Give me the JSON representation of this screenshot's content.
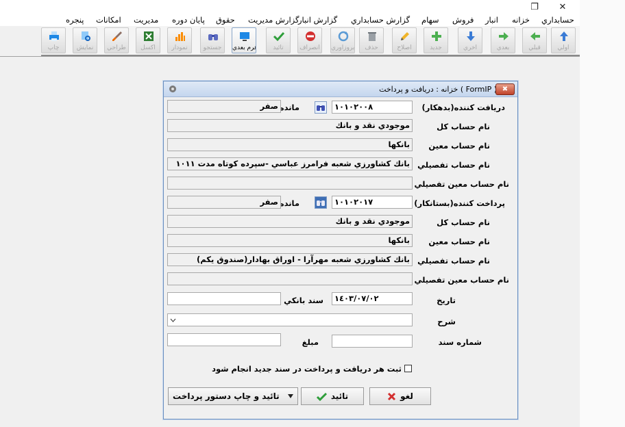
{
  "window": {
    "close_glyph": "✕",
    "restore_glyph": "❐"
  },
  "menu": [
    "حسابداري",
    "خزانه",
    "انبار",
    "فروش",
    "سهام",
    "گزارش حسابداري",
    "گزارش انبار",
    "گزارش مديريت",
    "حقوق",
    "پايان دوره",
    "مديريت",
    "امكانات",
    "پنجره"
  ],
  "toolbar": [
    {
      "label": "اولي",
      "icon": "up-arrow-icon"
    },
    {
      "label": "قبلي",
      "icon": "left-arrow-icon"
    },
    {
      "label": "بعدي",
      "icon": "right-arrow-icon"
    },
    {
      "label": "آخري",
      "icon": "down-arrow-icon"
    },
    {
      "label": "جديد",
      "icon": "plus-icon"
    },
    {
      "label": "اصلاح",
      "icon": "pencil-icon"
    },
    {
      "label": "حذف",
      "icon": "trash-icon"
    },
    {
      "label": "بروزآوري",
      "icon": "refresh-icon"
    },
    {
      "label": "انصراف",
      "icon": "cancel-icon"
    },
    {
      "label": "تائيد",
      "icon": "check-icon"
    },
    {
      "label": "فرم بعدي",
      "icon": "monitor-icon"
    },
    {
      "label": "جستجو",
      "icon": "binoculars-icon"
    },
    {
      "label": "نمودار",
      "icon": "chart-icon"
    },
    {
      "label": "اكسل",
      "icon": "excel-icon"
    },
    {
      "label": "طراحي",
      "icon": "brush-icon"
    },
    {
      "label": "نمايش",
      "icon": "preview-icon"
    },
    {
      "label": "چاپ",
      "icon": "printer-icon"
    }
  ],
  "dialog": {
    "title": "خزانه : دريافت و پرداخت ( FormIP )",
    "close": "✖",
    "receiver": {
      "label": "دريافت كننده(بدهكار)",
      "code": "١٠١٠٢٠٠٨",
      "balance_label": "مانده",
      "balance": "صفر",
      "general_label": "نام حساب كل",
      "general": "موجودي نقد و بانك",
      "specific_label": "نام حساب معين",
      "specific": "بانكها",
      "detail_label": "نام حساب تفصيلي",
      "detail": "بانك كشاورزي شعبه فرامرز عباسي -سپرده كوتاه مدت ١٠١١",
      "specific_detail_label": "نام حساب معين تفصيلي",
      "specific_detail": ""
    },
    "payer": {
      "label": "پرداخت كننده(بستانكار)",
      "code": "١٠١٠٢٠١٧",
      "balance_label": "مانده",
      "balance": "صفر",
      "general_label": "نام حساب كل",
      "general": "موجودي نقد و بانك",
      "specific_label": "نام حساب معين",
      "specific": "بانكها",
      "detail_label": "نام حساب تفصيلي",
      "detail": "بانك كشاورزي شعبه مهرآرا - اوراق بهادار(صندوق يكم)",
      "specific_detail_label": "نام حساب معين تفصيلي",
      "specific_detail": ""
    },
    "date_label": "تاريخ",
    "date": "١٤٠٣/٠٧/٠٢",
    "bank_doc_label": "سند بانكي",
    "bank_doc": "",
    "description_label": "شرح",
    "description": "",
    "doc_number_label": "شماره سند",
    "doc_number": "",
    "amount_label": "مبلغ",
    "amount": "",
    "checkbox_label": "ثبت هر دريافت و پرداخت در سند جديد انجام شود",
    "checkbox_checked": false,
    "buttons": {
      "cancel": "لغو",
      "confirm": "تائيد",
      "confirm_print": "تائيد و چاپ دستور پرداخت"
    }
  }
}
